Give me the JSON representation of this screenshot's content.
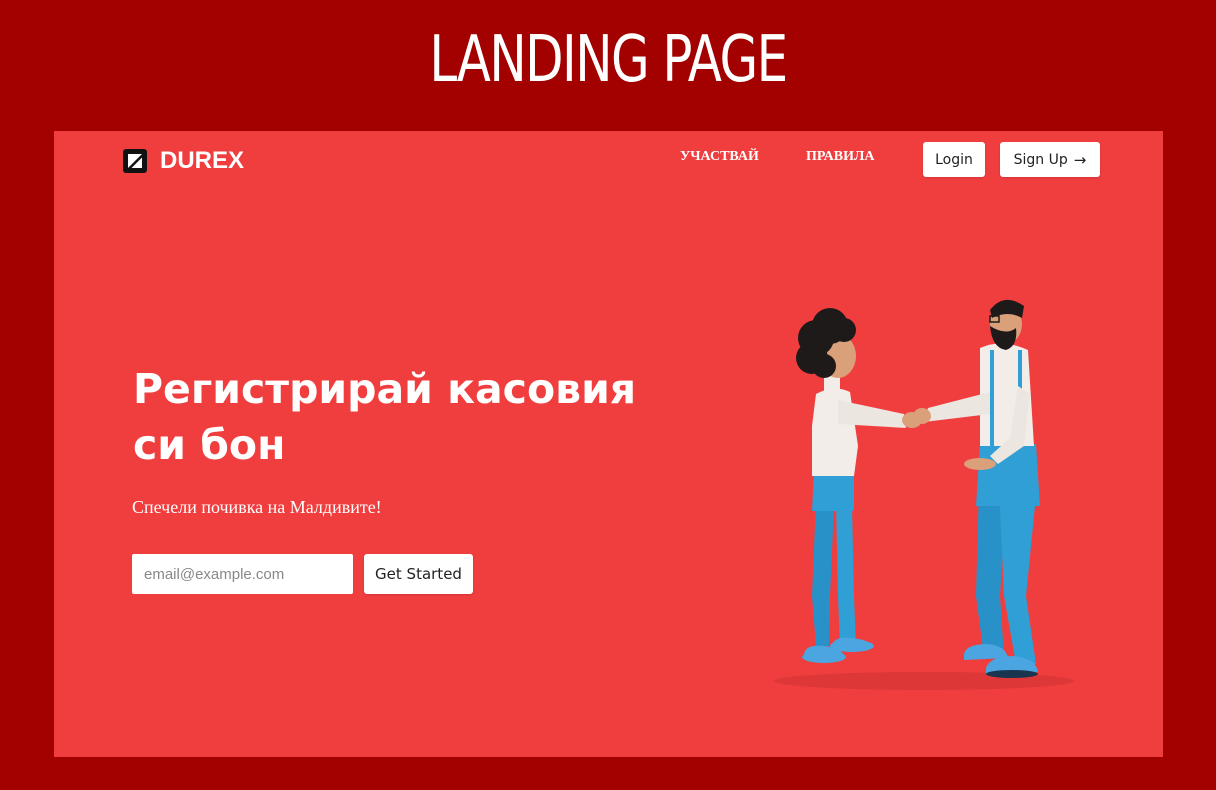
{
  "page": {
    "heading": "LANDING PAGE"
  },
  "navbar": {
    "logo_text": "DUREX",
    "links": [
      {
        "label": "УЧАСТВАЙ"
      },
      {
        "label": "ПРАВИЛА"
      }
    ],
    "login_label": "Login",
    "signup_label": "Sign Up"
  },
  "hero": {
    "title": "Регистрирай касовия си бон",
    "subtitle": "Спечели почивка на Малдивите!",
    "email_placeholder": "email@example.com",
    "email_value": "",
    "cta_label": "Get Started"
  },
  "illustration": {
    "icon": "handshake-people-illustration"
  },
  "colors": {
    "outer_background": "#a30000",
    "frame_background": "#f03e3f",
    "pants_blue": "#2f9fd6",
    "shirt_white": "#f2ede8"
  }
}
